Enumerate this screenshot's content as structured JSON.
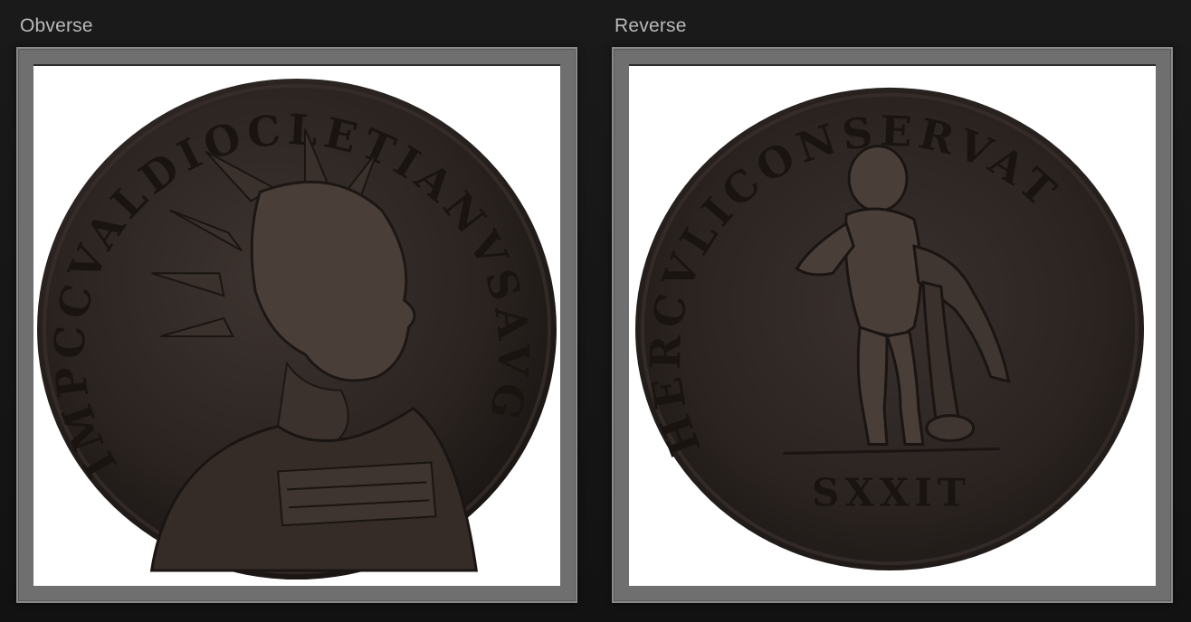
{
  "panels": {
    "obverse": {
      "label": "Obverse",
      "legend": "IMPCCVALDIOCLETIANVSAVG"
    },
    "reverse": {
      "label": "Reverse",
      "legend": "HERCVLICONSERVAT",
      "exergue": "SXXIT"
    }
  },
  "colors": {
    "background": "#141414",
    "frame": "#6f6f6f",
    "image_bg": "#ffffff",
    "coin_metal": "#2c2522"
  }
}
